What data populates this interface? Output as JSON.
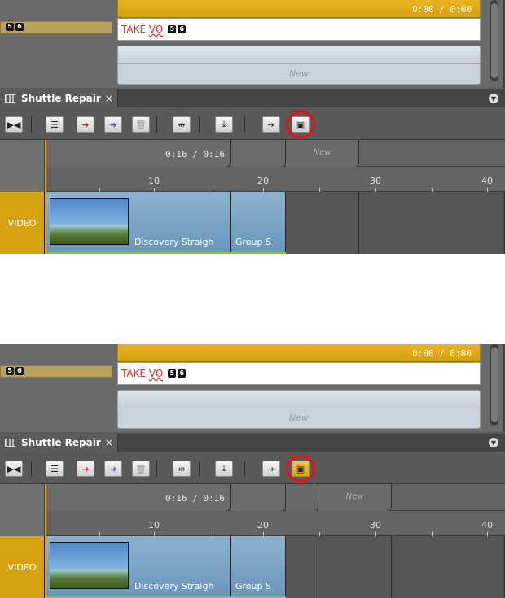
{
  "colors": {
    "accent": "#d8a312",
    "ring": "#e01616",
    "title_red": "#e62a2a"
  },
  "panel_top": {
    "timecode": "0:00 / 0:00",
    "story_title_a": "TAKE ",
    "story_title_b": "VO",
    "badges": [
      "5",
      "6"
    ],
    "new_group": "New",
    "tab_label": "Shuttle Repair",
    "tab_close": "×",
    "sequence_timecode": "0:16 / 0:16",
    "segment_new": "New",
    "ruler_ticks": [
      "10",
      "20",
      "30",
      "40"
    ],
    "track_label": "VIDEO",
    "clips": [
      "Discovery Straigh",
      "Group S"
    ],
    "highlight_button_state": "inactive"
  },
  "panel_bottom": {
    "timecode": "0:00 / 0:00",
    "story_title_a": "TAKE ",
    "story_title_b": "VO",
    "badges": [
      "5",
      "6"
    ],
    "new_group": "New",
    "tab_label": "Shuttle Repair",
    "tab_close": "×",
    "sequence_timecode": "0:16 / 0:16",
    "segment_new": "New",
    "ruler_ticks": [
      "10",
      "20",
      "30",
      "40"
    ],
    "track_label": "VIDEO",
    "clips": [
      "Discovery Straigh",
      "Group S"
    ],
    "highlight_button_state": "active"
  },
  "toolbar_icons": [
    "play-stop-icon",
    "storyline-icon",
    "insert-red-icon",
    "insert-blue-icon",
    "trash-icon",
    "waveform-icon",
    "download-icon",
    "send-icon",
    "highlight-clip-icon"
  ]
}
